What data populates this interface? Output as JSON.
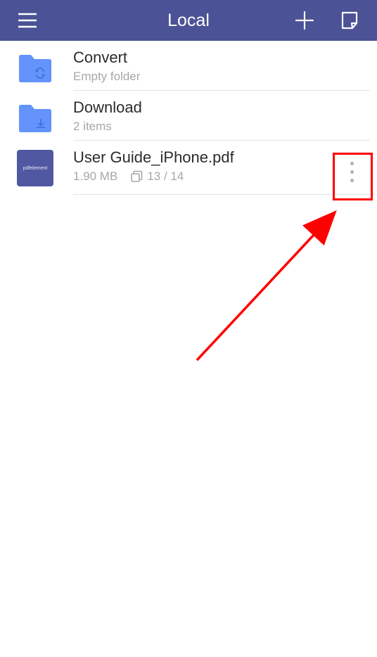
{
  "header": {
    "title": "Local"
  },
  "items": [
    {
      "name": "Convert",
      "meta": "Empty folder",
      "type": "folder",
      "folder_kind": "sync"
    },
    {
      "name": "Download",
      "meta": "2 items",
      "type": "folder",
      "folder_kind": "download"
    },
    {
      "name": "User Guide_iPhone.pdf",
      "size": "1.90 MB",
      "pages": "13 / 14",
      "type": "file",
      "thumb_label": "pdfelement"
    }
  ],
  "colors": {
    "header_bg": "#4b5296",
    "folder": "#6393fb",
    "pdf_thumb": "#5158a2",
    "annotation": "#f00"
  }
}
